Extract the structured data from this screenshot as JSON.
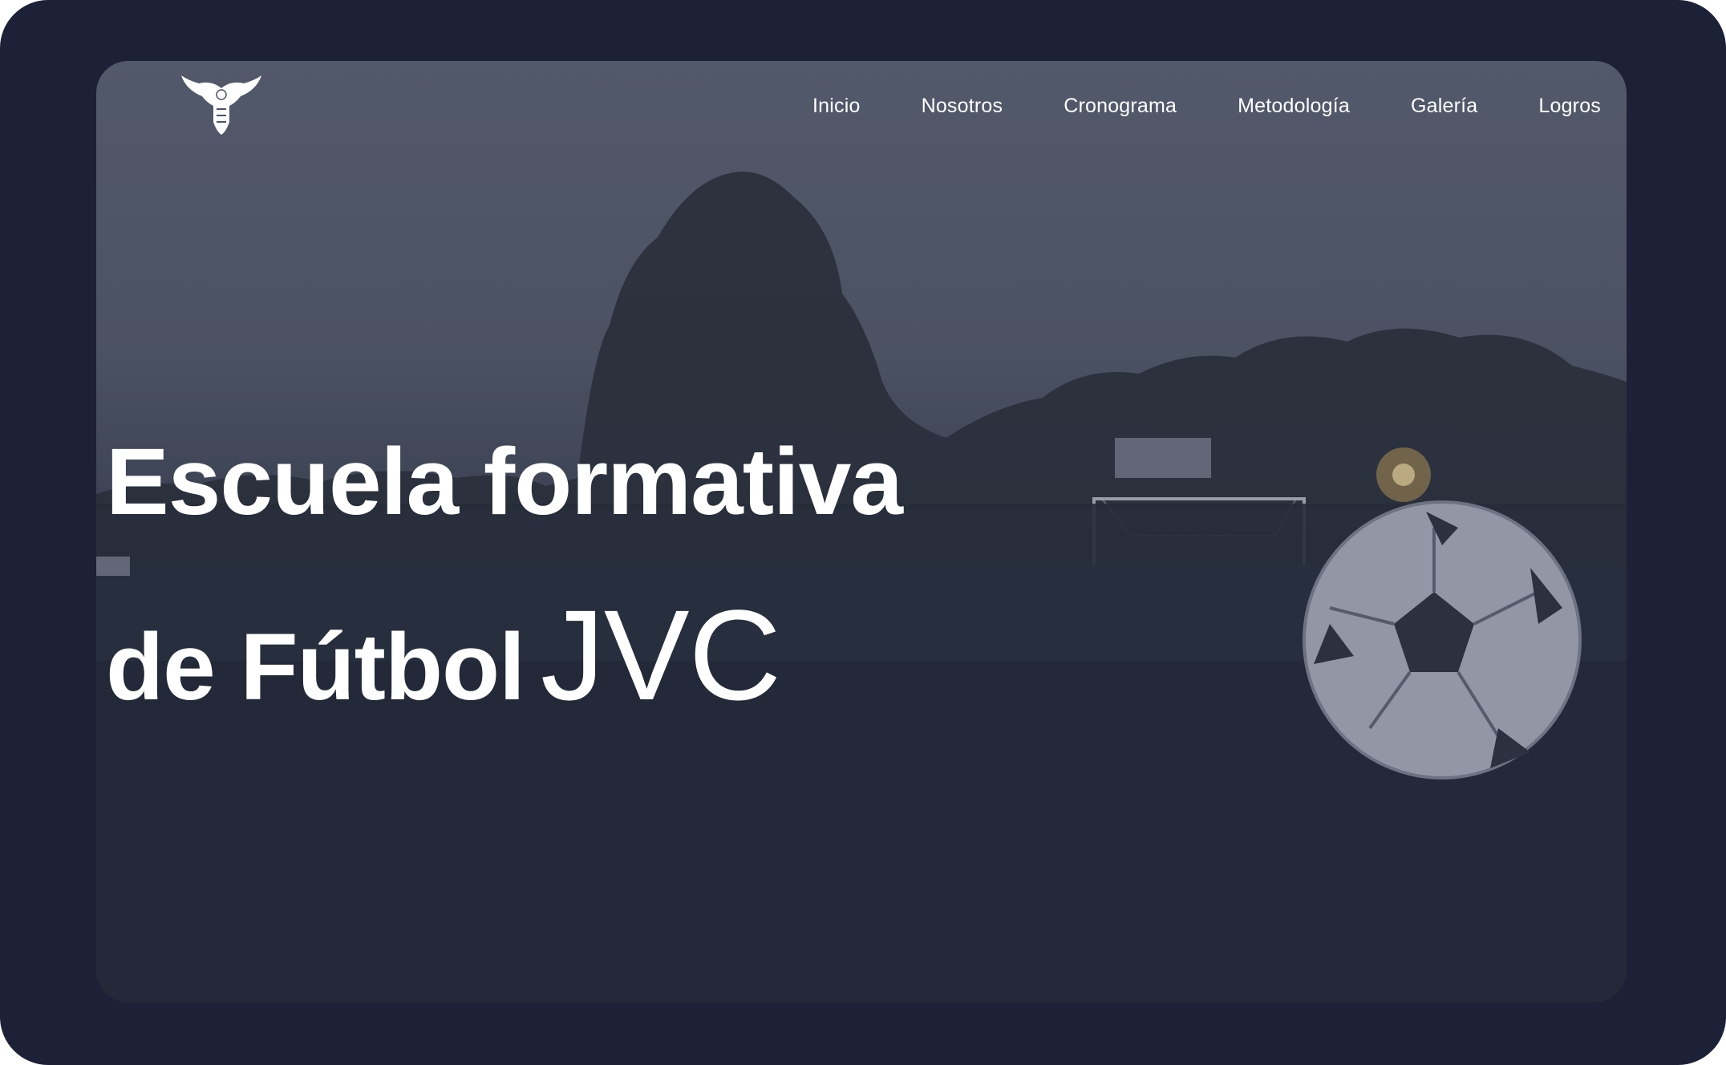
{
  "nav": {
    "items": [
      {
        "label": "Inicio"
      },
      {
        "label": "Nosotros"
      },
      {
        "label": "Cronograma"
      },
      {
        "label": "Metodología"
      },
      {
        "label": "Galería"
      },
      {
        "label": "Logros"
      }
    ]
  },
  "hero": {
    "title_line1": "Escuela formativa",
    "title_line2_prefix": "de Fútbol",
    "title_line2_brand": "JVC"
  },
  "colors": {
    "frame": "#1d2137",
    "text": "#ffffff",
    "overlay": "#4b5365"
  },
  "icons": {
    "logo": "eagle-logo-icon"
  }
}
